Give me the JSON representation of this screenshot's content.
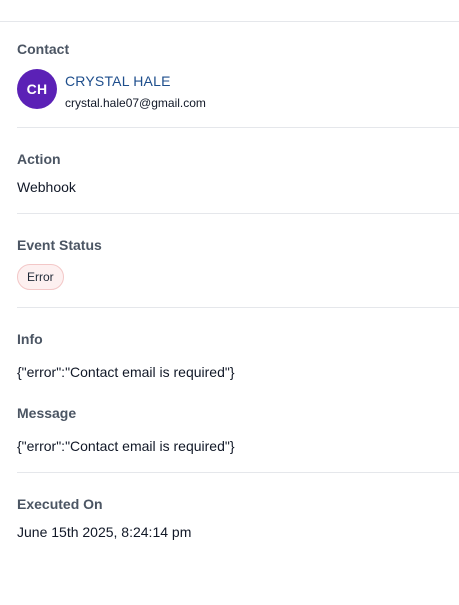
{
  "contact": {
    "label": "Contact",
    "initials": "CH",
    "name": "CRYSTAL HALE",
    "email": "crystal.hale07@gmail.com",
    "avatar_color": "#5b21b6",
    "name_color": "#1e4e8c"
  },
  "action": {
    "label": "Action",
    "value": "Webhook"
  },
  "event_status": {
    "label": "Event Status",
    "badge": "Error",
    "badge_bg": "#fdf0f0"
  },
  "info": {
    "label": "Info",
    "value": "{\"error\":\"Contact email is required\"}"
  },
  "message": {
    "label": "Message",
    "value": "{\"error\":\"Contact email is required\"}"
  },
  "executed_on": {
    "label": "Executed On",
    "value": "June 15th 2025, 8:24:14 pm"
  }
}
